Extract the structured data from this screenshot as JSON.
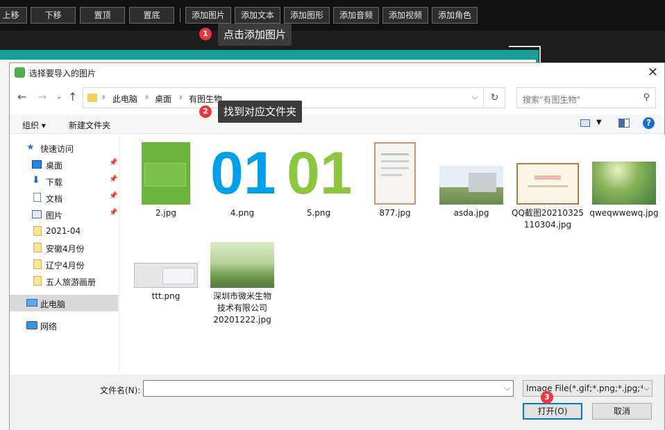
{
  "toolbar": {
    "buttons": [
      "上移",
      "下移",
      "置顶",
      "置底",
      "添加图片",
      "添加文本",
      "添加图形",
      "添加音频",
      "添加视频",
      "添加角色"
    ]
  },
  "annotations": [
    {
      "num": "1",
      "text": "点击添加图片"
    },
    {
      "num": "2",
      "text": "找到对应文件夹"
    },
    {
      "num": "3",
      "text": ""
    }
  ],
  "dialog": {
    "title": "选择要导入的图片",
    "close": "✕",
    "address": [
      "此电脑",
      "桌面",
      "有图生物"
    ],
    "search_placeholder": "搜索\"有图生物\"",
    "organize": "组织 ▾",
    "new_folder": "新建文件夹",
    "help": "?",
    "sidebar": [
      {
        "label": "快速访问",
        "icon": "star-icon"
      },
      {
        "label": "桌面",
        "icon": "desktop-icon",
        "pinned": true
      },
      {
        "label": "下载",
        "icon": "download-icon",
        "pinned": true
      },
      {
        "label": "文档",
        "icon": "document-icon",
        "pinned": true
      },
      {
        "label": "图片",
        "icon": "pictures-icon",
        "pinned": true
      },
      {
        "label": "2021-04",
        "icon": "folder-icon"
      },
      {
        "label": "安徽4月份",
        "icon": "folder-icon"
      },
      {
        "label": "辽宁4月份",
        "icon": "folder-icon"
      },
      {
        "label": "五人旅游画册",
        "icon": "folder-icon"
      },
      {
        "label": "此电脑",
        "icon": "computer-icon"
      },
      {
        "label": "网络",
        "icon": "network-icon"
      }
    ],
    "files": [
      {
        "name": "2.jpg"
      },
      {
        "name": "4.png",
        "glyph": "01"
      },
      {
        "name": "5.png",
        "glyph": "01"
      },
      {
        "name": "877.jpg"
      },
      {
        "name": "asda.jpg"
      },
      {
        "name": "QQ截图20210325110304.jpg"
      },
      {
        "name": "qweqwwewq.jpg"
      },
      {
        "name": "ttt.png"
      },
      {
        "name": "深圳市微米生物技术有限公司20201222.jpg"
      }
    ],
    "filename_label": "文件名(N):",
    "filename_value": "",
    "filetype": "Image File(*.gif;*.png;*.jpg;*.j",
    "open_button": "打开(O)",
    "cancel_button": "取消"
  },
  "colors": {
    "accent": "#0078d7",
    "badge": "#e8383d",
    "teal": "#199e98"
  }
}
